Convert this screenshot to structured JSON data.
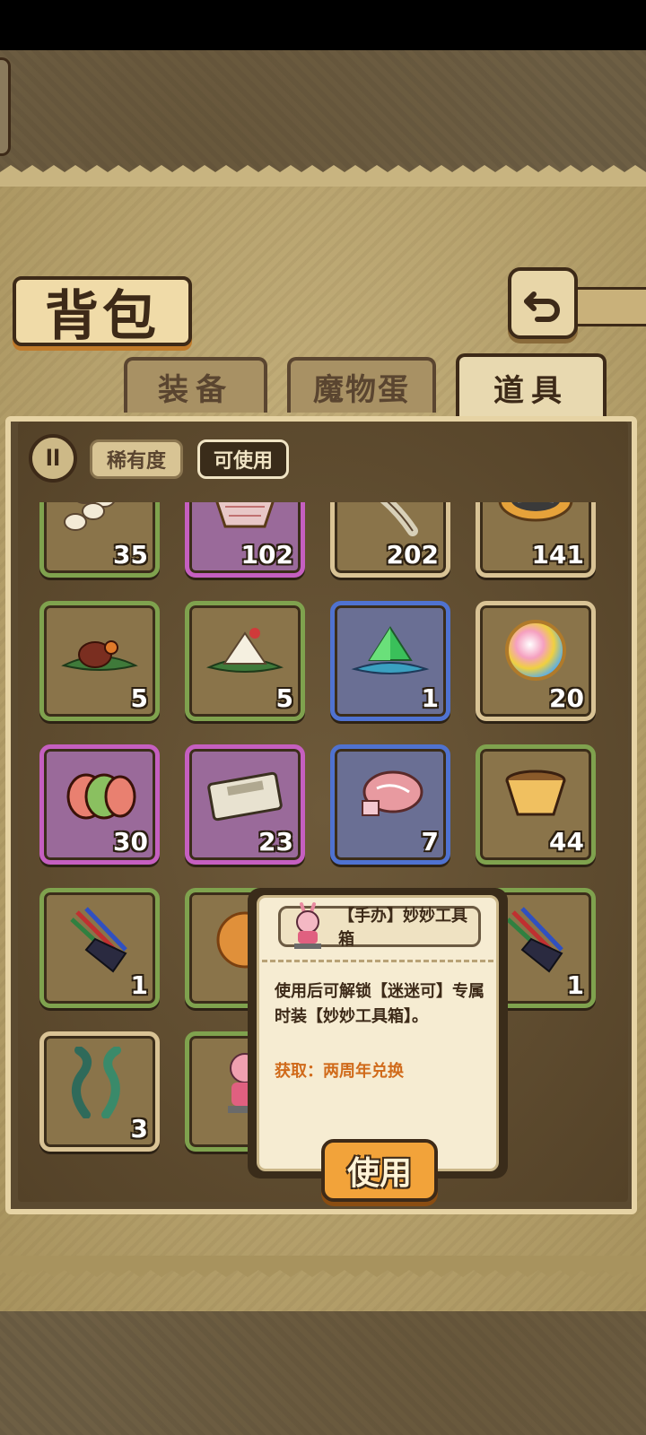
{
  "header": {
    "title": "背包"
  },
  "tabs": [
    {
      "label": "装备",
      "active": false
    },
    {
      "label": "魔物蛋",
      "active": false
    },
    {
      "label": "道具",
      "active": true
    }
  ],
  "filters": {
    "sort_icon": "ll",
    "rarity_label": "稀有度",
    "usable_label": "可使用"
  },
  "items": [
    {
      "qty": "35",
      "rarity": "green",
      "icon": "eggs-icon"
    },
    {
      "qty": "102",
      "rarity": "purple",
      "icon": "bread-basket-icon"
    },
    {
      "qty": "202",
      "rarity": "beige",
      "icon": "fish-icon"
    },
    {
      "qty": "141",
      "rarity": "beige",
      "icon": "mooncake-tart-icon"
    },
    {
      "qty": "5",
      "rarity": "green",
      "icon": "meat-on-leaf-icon"
    },
    {
      "qty": "5",
      "rarity": "green",
      "icon": "rice-dumpling-icon"
    },
    {
      "qty": "1",
      "rarity": "blue",
      "icon": "green-crystal-icon"
    },
    {
      "qty": "20",
      "rarity": "beige",
      "icon": "rainbow-orb-icon"
    },
    {
      "qty": "30",
      "rarity": "purple",
      "icon": "ham-slices-icon"
    },
    {
      "qty": "23",
      "rarity": "purple",
      "icon": "banknotes-icon"
    },
    {
      "qty": "7",
      "rarity": "blue",
      "icon": "marbled-meat-icon"
    },
    {
      "qty": "44",
      "rarity": "green",
      "icon": "pudding-icon"
    },
    {
      "qty": "1",
      "rarity": "green",
      "icon": "brush-pouch-icon"
    },
    {
      "qty": "",
      "rarity": "green",
      "icon": "mooncake-icon"
    },
    {
      "qty": "",
      "rarity": "green",
      "icon": "hidden-icon"
    },
    {
      "qty": "1",
      "rarity": "green",
      "icon": "brush-pouch-icon"
    },
    {
      "qty": "3",
      "rarity": "beige",
      "icon": "seaweed-icon"
    },
    {
      "qty": "",
      "rarity": "green",
      "icon": "figurine-icon"
    }
  ],
  "tooltip": {
    "title": "【手办】妙妙工具箱",
    "description": "使用后可解锁【迷迷可】专属时装【妙妙工具箱】。",
    "source": "获取：两周年兑换",
    "use_button": "使用"
  },
  "colors": {
    "green": "#7fa24e",
    "purple": "#c55fc0",
    "blue": "#4f72d0",
    "beige": "#d9c395",
    "accent_orange": "#f2a33a",
    "source_text": "#d06a1a"
  }
}
